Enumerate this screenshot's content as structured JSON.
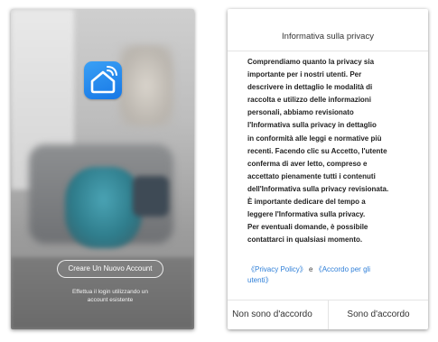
{
  "left_screen": {
    "create_account_label": "Creare Un Nuovo Account",
    "login_line1": "Effettua il login utilizzando un",
    "login_line2": "account esistente",
    "logo_icon": "smart-home-wifi-icon",
    "brand_color": "#1a85ee"
  },
  "privacy_dialog": {
    "title": "Informativa sulla privacy",
    "body_lines": [
      "Comprendiamo quanto la privacy sia",
      "importante per i nostri utenti. Per",
      "descrivere in dettaglio le modalità di",
      "raccolta e utilizzo delle informazioni",
      "personali, abbiamo revisionato",
      "l'Informativa sulla privacy in dettaglio",
      "in conformità alle leggi e normative più",
      "recenti. Facendo clic su Accetto, l'utente",
      "conferma di aver letto, compreso e",
      "accettato pienamente tutti i contenuti",
      "dell'Informativa sulla privacy revisionata.",
      "È importante dedicare del tempo a",
      "leggere l'Informativa sulla privacy.",
      "Per eventuali domande, è possibile",
      "contattarci in qualsiasi momento."
    ],
    "privacy_policy_link": "《Privacy Policy》",
    "and_text": "e",
    "terms_link_line1": "《Accordo per gli",
    "terms_link_line2": "utenti》",
    "decline_label": "Non sono d'accordo",
    "accept_label": "Sono d'accordo",
    "link_color": "#2f7fd8"
  }
}
